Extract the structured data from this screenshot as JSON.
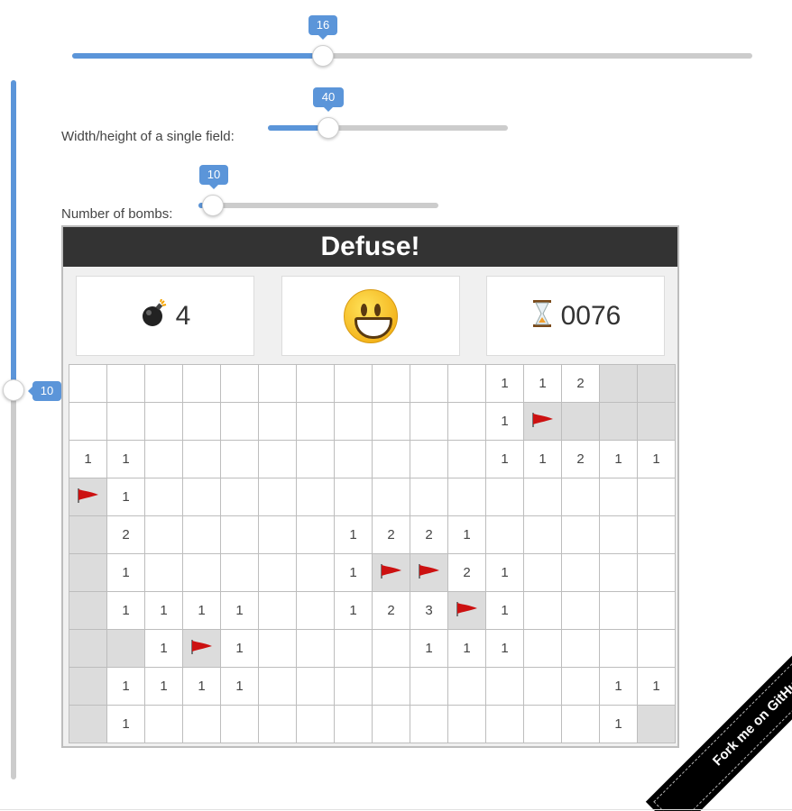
{
  "sliders": {
    "columns": {
      "value": "16"
    },
    "field_size": {
      "label": "Width/height of a single field:",
      "value": "40"
    },
    "bombs": {
      "label": "Number of bombs:",
      "value": "10"
    },
    "rows": {
      "value": "10"
    }
  },
  "game": {
    "title": "Defuse!",
    "bombs_left": "4",
    "timer": "0076",
    "bomb_icon": "bomb-icon",
    "timer_icon": "hourglass-icon",
    "smiley_icon": "smiley-face-icon",
    "colors": {
      "header": "#333333",
      "hidden_cell": "#dcdcdc",
      "flag": "#cc1111",
      "accent": "#5b95d9"
    },
    "board": [
      [
        "",
        "",
        "",
        "",
        "",
        "",
        "",
        "",
        "",
        "",
        "",
        "1",
        "1",
        "2",
        "H",
        "H"
      ],
      [
        "",
        "",
        "",
        "",
        "",
        "",
        "",
        "",
        "",
        "",
        "",
        "1",
        "F",
        "H",
        "H",
        "H"
      ],
      [
        "1",
        "1",
        "",
        "",
        "",
        "",
        "",
        "",
        "",
        "",
        "",
        "1",
        "1",
        "2",
        "1",
        "1"
      ],
      [
        "F",
        "1",
        "",
        "",
        "",
        "",
        "",
        "",
        "",
        "",
        "",
        "",
        "",
        "",
        "",
        ""
      ],
      [
        "H",
        "2",
        "",
        "",
        "",
        "",
        "",
        "1",
        "2",
        "2",
        "1",
        "",
        "",
        "",
        "",
        ""
      ],
      [
        "H",
        "1",
        "",
        "",
        "",
        "",
        "",
        "1",
        "F",
        "F",
        "2",
        "1",
        "",
        "",
        "",
        ""
      ],
      [
        "H",
        "1",
        "1",
        "1",
        "1",
        "",
        "",
        "1",
        "2",
        "3",
        "F",
        "1",
        "",
        "",
        "",
        ""
      ],
      [
        "H",
        "H",
        "1",
        "F",
        "1",
        "",
        "",
        "",
        "",
        "1",
        "1",
        "1",
        "",
        "",
        "",
        ""
      ],
      [
        "H",
        "1",
        "1",
        "1",
        "1",
        "",
        "",
        "",
        "",
        "",
        "",
        "",
        "",
        "",
        "1",
        "1"
      ],
      [
        "H",
        "1",
        "",
        "",
        "",
        "",
        "",
        "",
        "",
        "",
        "",
        "",
        "",
        "",
        "1",
        "H"
      ]
    ]
  },
  "ribbon": {
    "label": "Fork me on GitHub"
  }
}
